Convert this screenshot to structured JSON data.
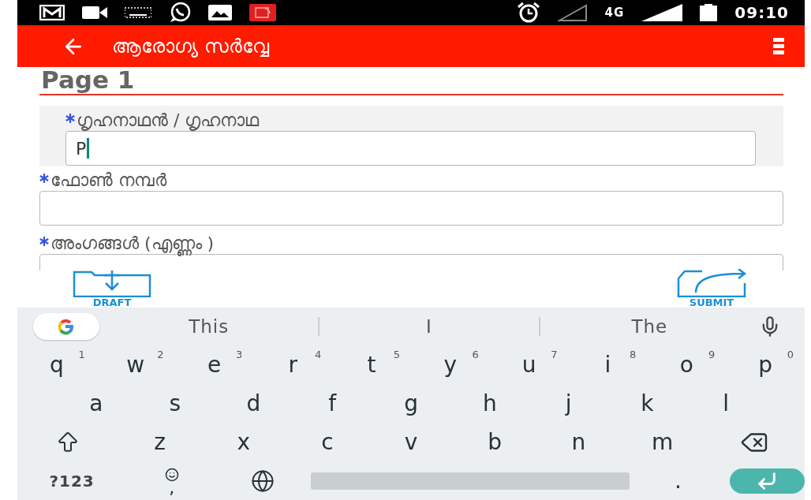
{
  "status_bar": {
    "network": "4G",
    "time": "09:10"
  },
  "app_bar": {
    "title": "ആരോഗ്യ സർവ്വേ"
  },
  "page": {
    "heading": "Page 1"
  },
  "fields": [
    {
      "label": "ഗൃഹനാഥൻ / ഗൃഹനാഥ",
      "required": true,
      "value": "P",
      "focused": true
    },
    {
      "label": "ഫോൺ നമ്പർ",
      "required": true,
      "focused": false
    },
    {
      "label": "അംഗങ്ങൾ (എണ്ണം )",
      "required": true,
      "focused": false
    }
  ],
  "actions": [
    {
      "kind": "draft",
      "label": "DRAFT"
    },
    {
      "kind": "submit",
      "label": "SUBMIT"
    }
  ],
  "keyboard": {
    "suggestions": [
      "This",
      "I",
      "The"
    ],
    "rows": [
      [
        {
          "kind": "letter",
          "key": "q",
          "hint": "1"
        },
        {
          "kind": "letter",
          "key": "w",
          "hint": "2"
        },
        {
          "kind": "letter",
          "key": "e",
          "hint": "3"
        },
        {
          "kind": "letter",
          "key": "r",
          "hint": "4"
        },
        {
          "kind": "letter",
          "key": "t",
          "hint": "5"
        },
        {
          "kind": "letter",
          "key": "y",
          "hint": "6"
        },
        {
          "kind": "letter",
          "key": "u",
          "hint": "7"
        },
        {
          "kind": "letter",
          "key": "i",
          "hint": "8"
        },
        {
          "kind": "letter",
          "key": "o",
          "hint": "9"
        },
        {
          "kind": "letter",
          "key": "p",
          "hint": "0"
        }
      ],
      [
        {
          "kind": "letter",
          "key": "a"
        },
        {
          "kind": "letter",
          "key": "s"
        },
        {
          "kind": "letter",
          "key": "d"
        },
        {
          "kind": "letter",
          "key": "f"
        },
        {
          "kind": "letter",
          "key": "g"
        },
        {
          "kind": "letter",
          "key": "h"
        },
        {
          "kind": "letter",
          "key": "j"
        },
        {
          "kind": "letter",
          "key": "k"
        },
        {
          "kind": "letter",
          "key": "l"
        }
      ],
      [
        {
          "kind": "shift"
        },
        {
          "kind": "letter",
          "key": "z"
        },
        {
          "kind": "letter",
          "key": "x"
        },
        {
          "kind": "letter",
          "key": "c"
        },
        {
          "kind": "letter",
          "key": "v"
        },
        {
          "kind": "letter",
          "key": "b"
        },
        {
          "kind": "letter",
          "key": "n"
        },
        {
          "kind": "letter",
          "key": "m"
        },
        {
          "kind": "backspace"
        }
      ],
      [
        {
          "kind": "symbols",
          "key": "?123"
        },
        {
          "kind": "emoji",
          "key": ","
        },
        {
          "kind": "globe"
        },
        {
          "kind": "space"
        },
        {
          "kind": "letter",
          "key": "."
        },
        {
          "kind": "enter"
        }
      ]
    ]
  }
}
